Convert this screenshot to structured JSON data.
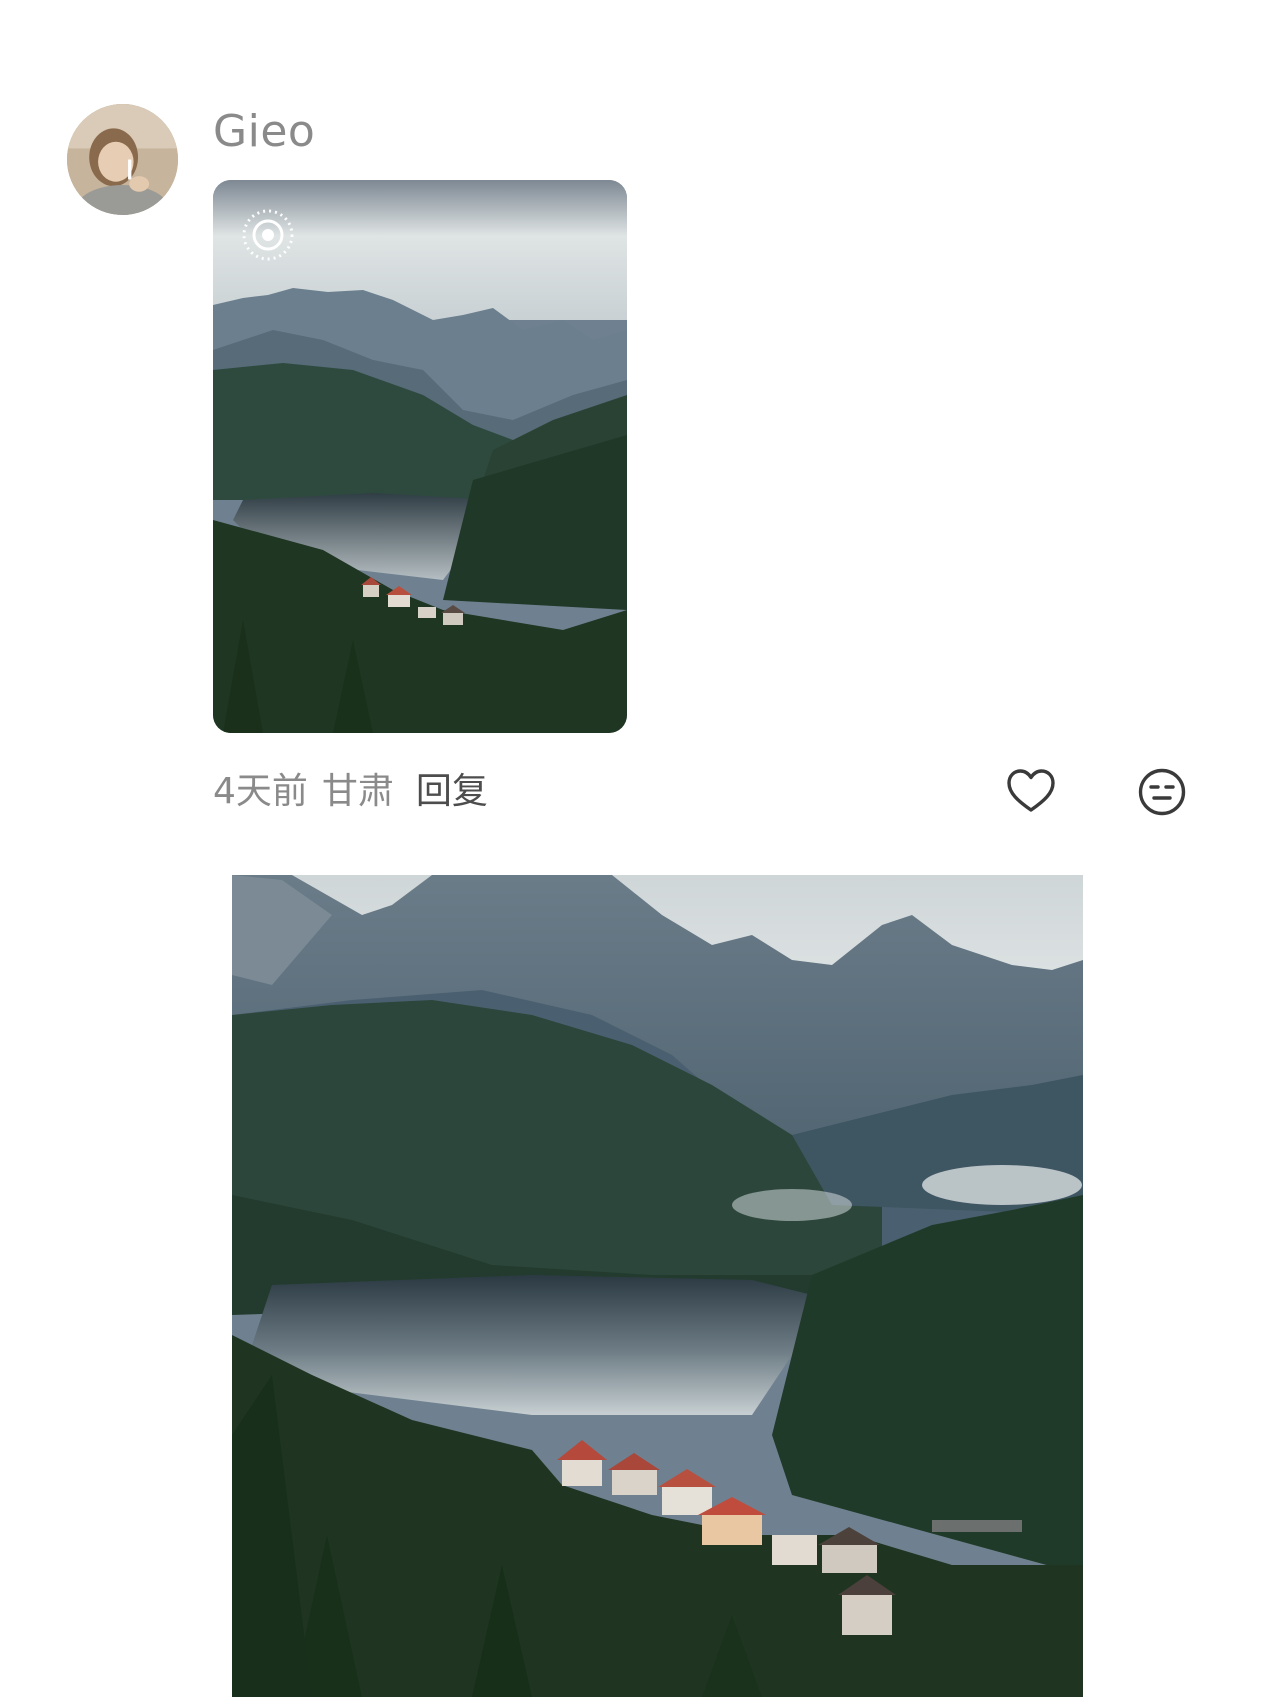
{
  "comment": {
    "author": {
      "name": "Gieo"
    },
    "time": "4天前",
    "location": "甘肃",
    "reply_label": "回复"
  },
  "icons": {
    "live_photo": "live-photo-icon",
    "like": "heart-outline-icon",
    "reaction": "neutral-face-icon"
  },
  "colors": {
    "muted_text": "#8a8a8a",
    "reply_text": "#4d4d4d",
    "icon_stroke": "#3a3a3a"
  }
}
